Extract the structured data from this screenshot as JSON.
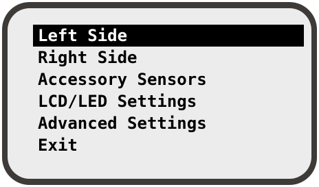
{
  "menu": {
    "items": [
      {
        "label": "Left Side",
        "selected": true
      },
      {
        "label": "Right Side",
        "selected": false
      },
      {
        "label": "Accessory Sensors",
        "selected": false
      },
      {
        "label": "LCD/LED Settings",
        "selected": false
      },
      {
        "label": "Advanced Settings",
        "selected": false
      },
      {
        "label": "Exit",
        "selected": false
      }
    ]
  },
  "colors": {
    "bezel": "#3d3a38",
    "screen": "#ececec",
    "highlight": "#000000",
    "highlight_text": "#ffffff",
    "text": "#000000"
  }
}
